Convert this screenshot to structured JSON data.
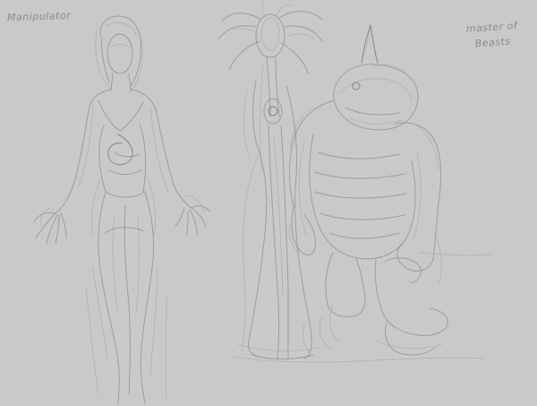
{
  "canvas": {
    "background": "#c9c9c9",
    "stroke_color": "#8d8d8d"
  },
  "labels": {
    "left": "Manipulator",
    "right_line1": "master of",
    "right_line2": "Beasts"
  }
}
